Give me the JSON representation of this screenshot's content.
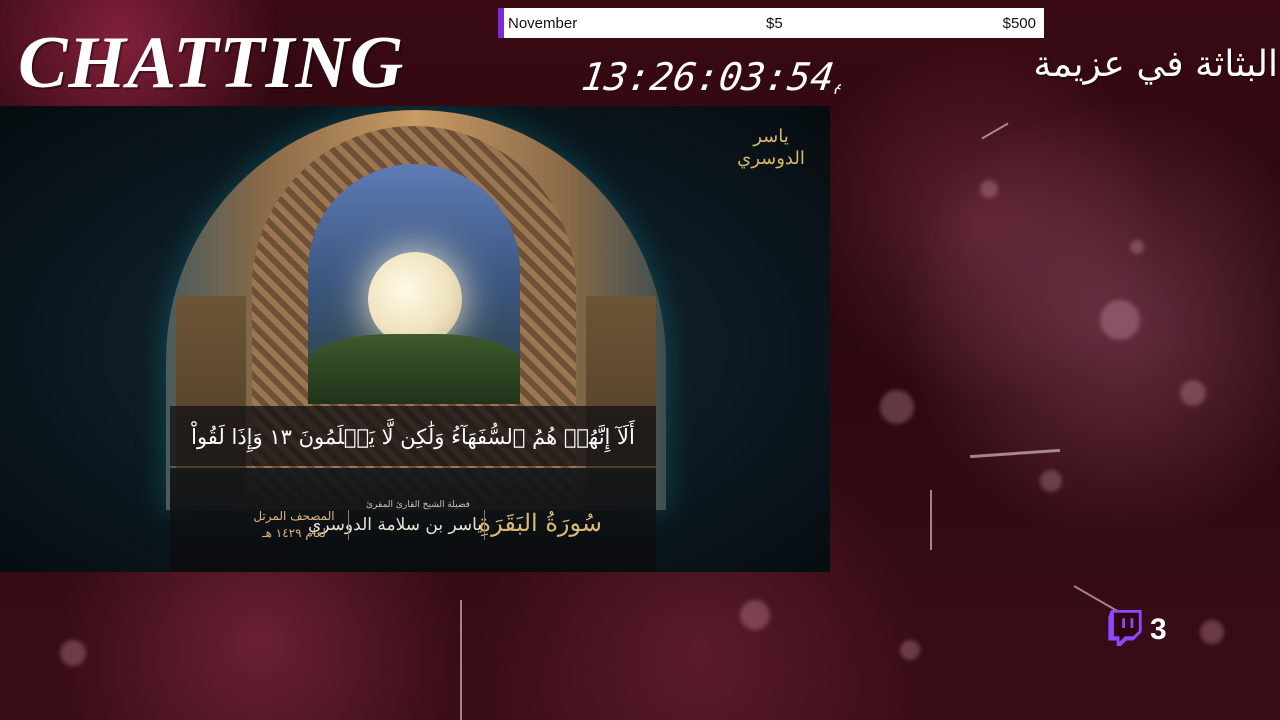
{
  "overlay": {
    "category_title": "CHATTING",
    "rtl_status": "البثاثة في عزيمة",
    "clock": {
      "time": "13:26:03:",
      "days_label": "أيام",
      "days_value": "54"
    }
  },
  "goal_bar": {
    "month": "November",
    "current": "$5",
    "target": "$500",
    "accent_color": "#7a2ad6"
  },
  "video": {
    "verse_text": "أَلَآ إِنَّهُمۡ هُمُ ٱلسُّفَهَآءُ وَلَٰكِن لَّا يَعۡلَمُونَ ١٣ وَإِذَا لَقُواْ",
    "surah_name": "سُورَةُ البَقَرَةِ",
    "reciter_caption": "فضيلة الشيخ القارئ المقرئ",
    "reciter_name": "ياسر بن سلامة الدوسري",
    "mushaf_line1": "المصحف المرتل",
    "mushaf_line2": "لعام ١٤٢٩ هـ",
    "seal_text": "ياسر الدوسري"
  },
  "twitch": {
    "icon": "twitch-logo-icon",
    "viewer_count": "3",
    "brand_color": "#9146ff"
  }
}
